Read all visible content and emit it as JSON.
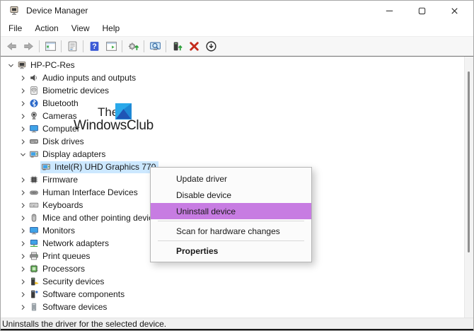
{
  "window": {
    "title": "Device Manager",
    "icon": "device-manager-icon"
  },
  "menubar": {
    "items": [
      "File",
      "Action",
      "View",
      "Help"
    ]
  },
  "toolbar": {
    "buttons": [
      {
        "name": "back",
        "icon": "back-icon"
      },
      {
        "name": "forward",
        "icon": "forward-icon"
      },
      {
        "sep": true
      },
      {
        "name": "show-hide-console-tree",
        "icon": "console-tree-icon"
      },
      {
        "sep": true
      },
      {
        "name": "properties",
        "icon": "properties-icon"
      },
      {
        "sep": true
      },
      {
        "name": "help",
        "icon": "help-icon"
      },
      {
        "name": "show-hide-action-pane",
        "icon": "action-pane-icon"
      },
      {
        "sep": true
      },
      {
        "name": "update-driver-software",
        "icon": "update-driver-software-icon"
      },
      {
        "sep": true
      },
      {
        "name": "scan-for-hardware-changes",
        "icon": "scan-hardware-icon"
      },
      {
        "sep": true
      },
      {
        "name": "update-device-driver",
        "icon": "device-update-icon"
      },
      {
        "name": "uninstall-device",
        "icon": "uninstall-icon"
      },
      {
        "name": "disable-device",
        "icon": "disable-icon"
      }
    ]
  },
  "tree": {
    "items": [
      {
        "label": "HP-PC-Res",
        "icon": "computer-icon",
        "level": 0,
        "state": "expanded"
      },
      {
        "label": "Audio inputs and outputs",
        "icon": "speaker-icon",
        "level": 1,
        "state": "collapsed"
      },
      {
        "label": "Biometric devices",
        "icon": "fingerprint-icon",
        "level": 1,
        "state": "collapsed"
      },
      {
        "label": "Bluetooth",
        "icon": "bluetooth-icon",
        "level": 1,
        "state": "collapsed"
      },
      {
        "label": "Cameras",
        "icon": "camera-icon",
        "level": 1,
        "state": "collapsed"
      },
      {
        "label": "Computer",
        "icon": "monitor-icon",
        "level": 1,
        "state": "collapsed"
      },
      {
        "label": "Disk drives",
        "icon": "disk-icon",
        "level": 1,
        "state": "collapsed"
      },
      {
        "label": "Display adapters",
        "icon": "display-adapter-icon",
        "level": 1,
        "state": "expanded"
      },
      {
        "label": "Intel(R) UHD Graphics 770",
        "icon": "display-adapter-icon",
        "level": 2,
        "state": "leaf",
        "selected": true
      },
      {
        "label": "Firmware",
        "icon": "chip-icon",
        "level": 1,
        "state": "collapsed"
      },
      {
        "label": "Human Interface Devices",
        "icon": "hid-icon",
        "level": 1,
        "state": "collapsed"
      },
      {
        "label": "Keyboards",
        "icon": "keyboard-icon",
        "level": 1,
        "state": "collapsed"
      },
      {
        "label": "Mice and other pointing devices",
        "icon": "mouse-icon",
        "level": 1,
        "state": "collapsed"
      },
      {
        "label": "Monitors",
        "icon": "monitor-icon",
        "level": 1,
        "state": "collapsed"
      },
      {
        "label": "Network adapters",
        "icon": "network-icon",
        "level": 1,
        "state": "collapsed"
      },
      {
        "label": "Print queues",
        "icon": "printer-icon",
        "level": 1,
        "state": "collapsed"
      },
      {
        "label": "Processors",
        "icon": "processor-icon",
        "level": 1,
        "state": "collapsed"
      },
      {
        "label": "Security devices",
        "icon": "security-icon",
        "level": 1,
        "state": "collapsed"
      },
      {
        "label": "Software components",
        "icon": "software-component-icon",
        "level": 1,
        "state": "collapsed"
      },
      {
        "label": "Software devices",
        "icon": "software-device-icon",
        "level": 1,
        "state": "collapsed"
      }
    ]
  },
  "watermark": {
    "text_top": "The",
    "text_bottom": "WindowsClub"
  },
  "context_menu": {
    "items": [
      {
        "label": "Update driver"
      },
      {
        "label": "Disable device"
      },
      {
        "label": "Uninstall device",
        "highlighted": true
      },
      {
        "sep": true
      },
      {
        "label": "Scan for hardware changes"
      },
      {
        "sep": true
      },
      {
        "label": "Properties",
        "bold": true
      }
    ]
  },
  "statusbar": {
    "text": "Uninstalls the driver for the selected device."
  },
  "colors": {
    "menu_highlight": "#c77ce2",
    "tree_selection": "#cce8ff",
    "watermark_logo_light": "#2aa9ea",
    "watermark_logo_dark": "#1f55b5",
    "uninstall_x_red": "#c42b1c"
  }
}
